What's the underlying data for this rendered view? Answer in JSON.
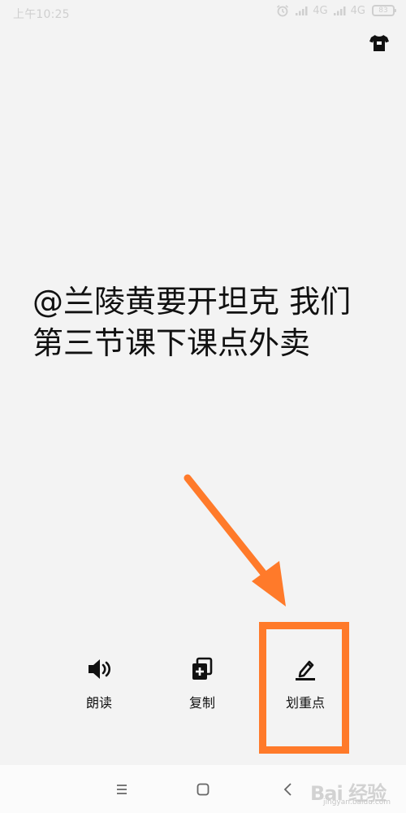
{
  "status_bar": {
    "time": "上午10:25",
    "net1": "4G",
    "net2": "4G",
    "battery": "83",
    "icons": [
      "alarm-icon",
      "signal-icon",
      "signal-icon",
      "battery-icon"
    ]
  },
  "toolbar": {
    "theme_icon": "tshirt-icon"
  },
  "content": {
    "line1": "@兰陵黄要开坦克 我们",
    "line2": "第三节课下课点外卖"
  },
  "actions": [
    {
      "label": "朗读",
      "icon": "speaker-icon"
    },
    {
      "label": "复制",
      "icon": "copy-icon"
    },
    {
      "label": "划重点",
      "icon": "highlight-pen-icon"
    }
  ],
  "annotation": {
    "color": "#ff7a2a",
    "target": "划重点"
  },
  "nav_bar": {
    "items": [
      "menu-icon",
      "home-icon",
      "back-icon"
    ]
  },
  "watermark": {
    "main": "Bai 经验",
    "sub": "jingyan.baidu.com"
  }
}
